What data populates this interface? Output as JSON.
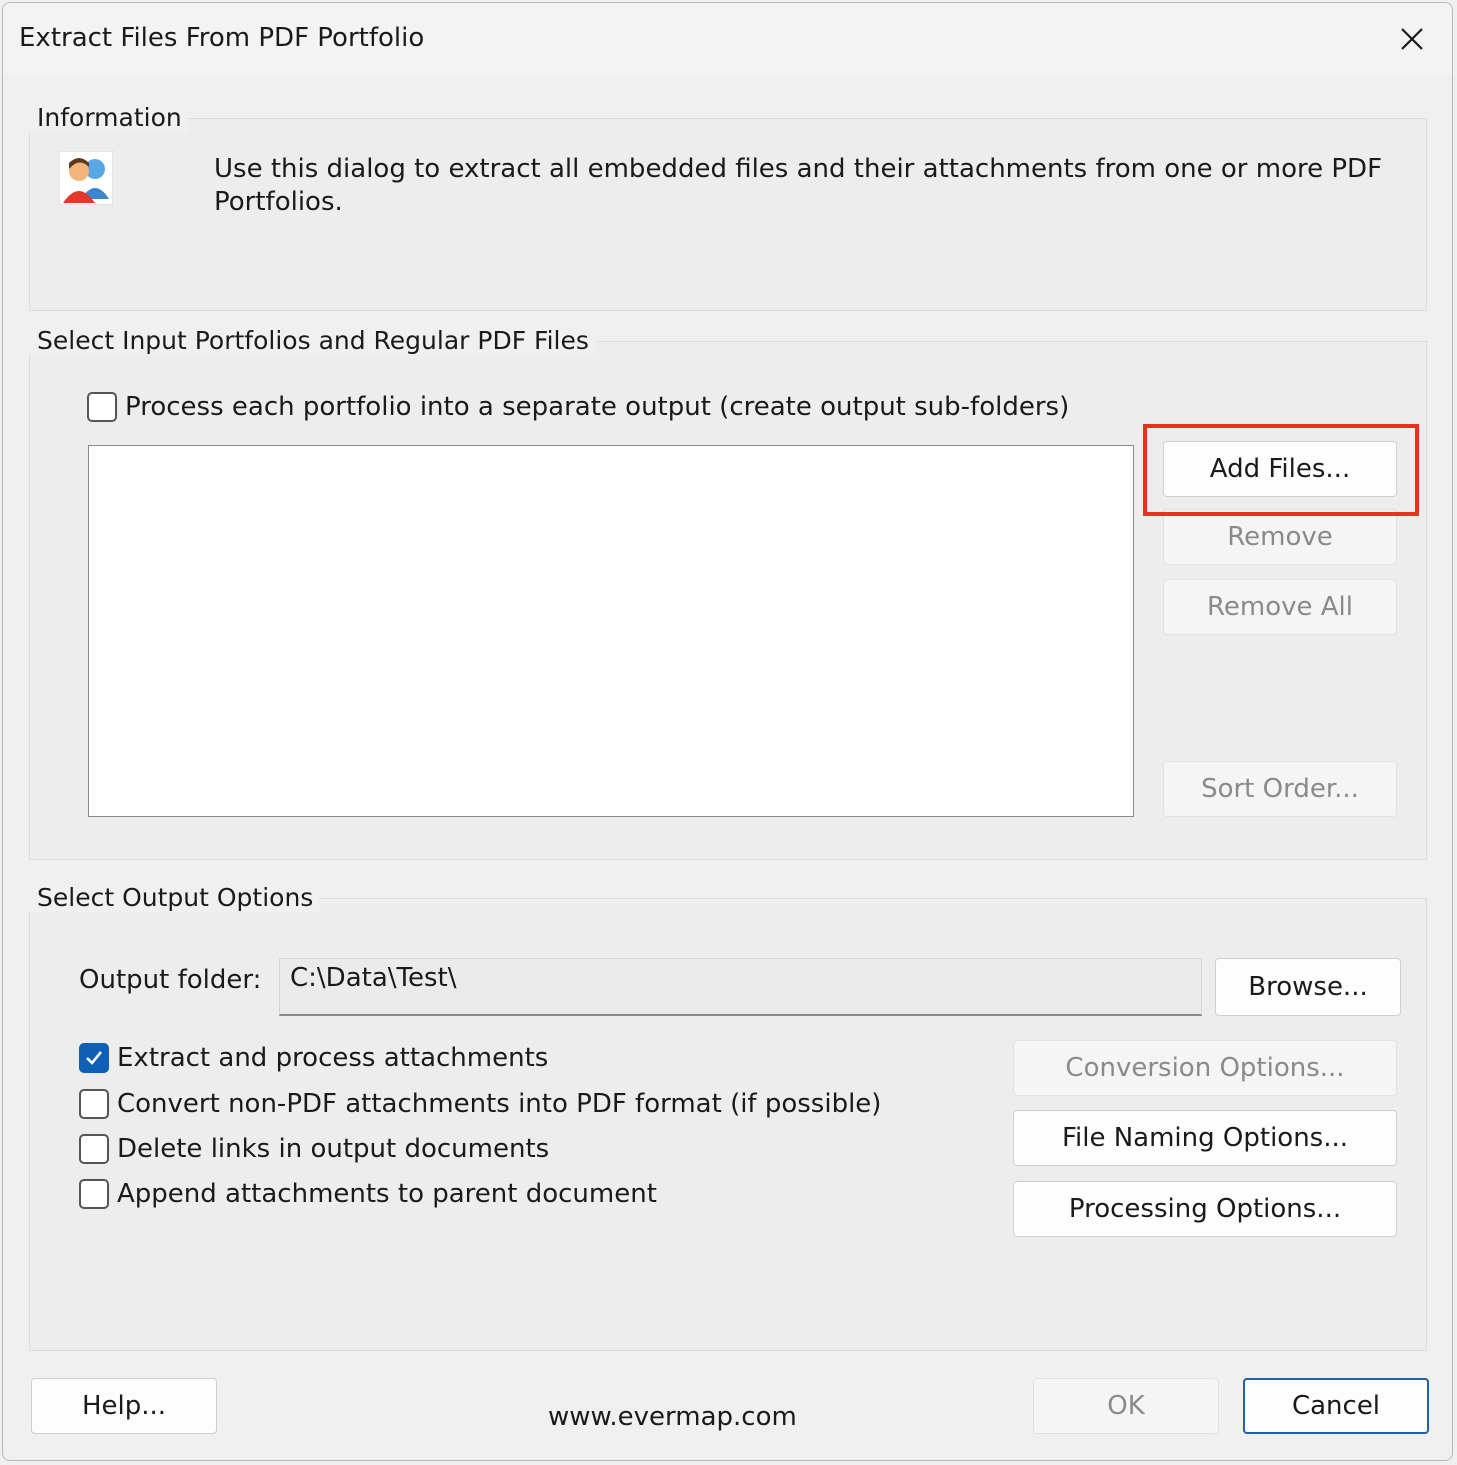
{
  "window": {
    "title": "Extract Files From PDF Portfolio"
  },
  "information": {
    "group_title": "Information",
    "text": "Use this dialog to extract all embedded files and their attachments from one or more PDF Portfolios."
  },
  "input": {
    "group_title": "Select Input Portfolios and Regular PDF Files",
    "separate_output_checkbox": {
      "label": "Process each portfolio into a separate output (create output sub-folders)",
      "checked": false
    },
    "files": [],
    "buttons": {
      "add_files": "Add Files...",
      "remove": "Remove",
      "remove_all": "Remove All",
      "sort_order": "Sort Order..."
    }
  },
  "output": {
    "group_title": "Select Output Options",
    "folder_label": "Output folder:",
    "folder_value": "C:\\Data\\Test\\",
    "browse": "Browse...",
    "options": [
      {
        "label": "Extract and process attachments",
        "checked": true
      },
      {
        "label": "Convert non-PDF attachments into PDF format (if possible)",
        "checked": false
      },
      {
        "label": "Delete links in output documents",
        "checked": false
      },
      {
        "label": "Append attachments to parent document",
        "checked": false
      }
    ],
    "buttons": {
      "conversion_options": "Conversion Options...",
      "file_naming_options": "File Naming Options...",
      "processing_options": "Processing Options..."
    }
  },
  "footer": {
    "help": "Help...",
    "website": "www.evermap.com",
    "ok": "OK",
    "cancel": "Cancel"
  },
  "colors": {
    "highlight": "#e8321e",
    "accent": "#0f5fb5"
  }
}
